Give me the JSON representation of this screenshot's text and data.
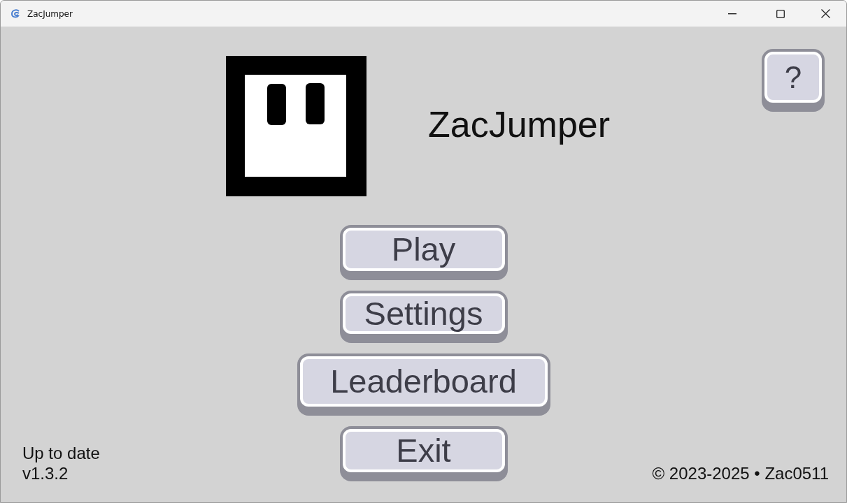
{
  "window": {
    "title": "ZacJumper"
  },
  "help_button": {
    "label": "?"
  },
  "game_title": "ZacJumper",
  "menu_buttons": [
    {
      "label": "Play"
    },
    {
      "label": "Settings"
    },
    {
      "label": "Leaderboard"
    },
    {
      "label": "Exit"
    }
  ],
  "update_status": "Up to date",
  "version": "v1.3.2",
  "copyright": "© 2023-2025 • Zac0511"
}
